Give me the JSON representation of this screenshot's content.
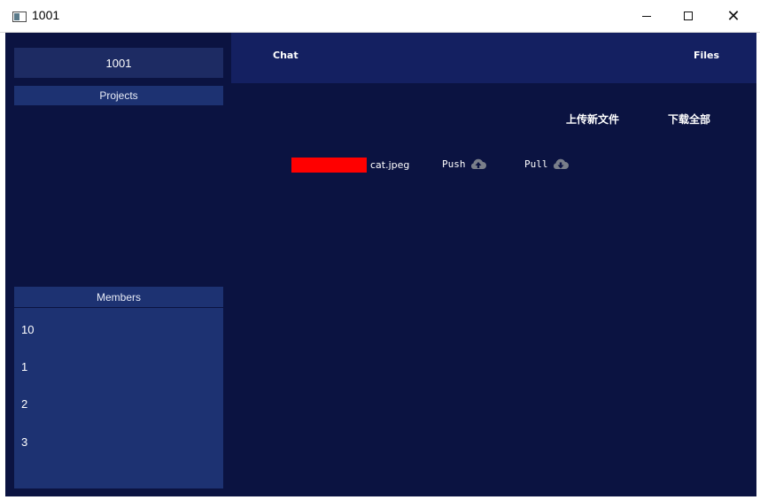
{
  "window": {
    "title": "1001"
  },
  "sidebar": {
    "room_name": "1001",
    "projects_label": "Projects",
    "members_label": "Members",
    "members": [
      "10",
      "1",
      "2",
      "3"
    ]
  },
  "nav": {
    "chat_label": "Chat",
    "files_label": "Files"
  },
  "files": {
    "upload_label": "上传新文件",
    "download_all_label": "下载全部",
    "items": [
      {
        "name": "cat.jpeg",
        "push_label": "Push",
        "pull_label": "Pull",
        "progress_color": "#ff0000"
      }
    ]
  },
  "colors": {
    "background": "#0b1341",
    "nav": "#142061",
    "panel": "#1d3272",
    "room_box": "#1d2b63"
  },
  "icons": {
    "push": "cloud-upload-icon",
    "pull": "cloud-download-icon"
  }
}
